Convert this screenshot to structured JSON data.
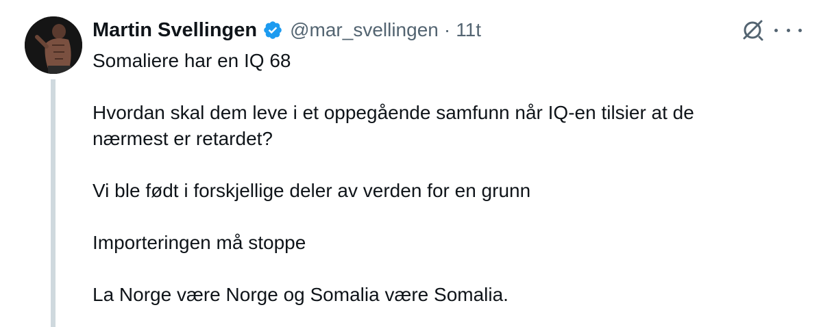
{
  "author": {
    "name": "Martin Svellingen",
    "handle": "@mar_svellingen",
    "separator": "·",
    "time": "11t",
    "verified": true,
    "verified_color": "#1d9bf0"
  },
  "icons": {
    "grok": "grok-icon",
    "more": "more-icon"
  },
  "tweet": {
    "lines": [
      "Somaliere har en IQ 68",
      "Hvordan skal dem leve i et oppegående samfunn når IQ-en tilsier at de",
      "nærmest er retardet?",
      "Vi ble født i forskjellige deler av verden for en grunn",
      "Importeringen må stoppe",
      "La Norge være Norge og Somalia være Somalia."
    ]
  },
  "colors": {
    "text": "#0f1419",
    "secondary": "#536471",
    "thread_line": "#cfd9de"
  }
}
